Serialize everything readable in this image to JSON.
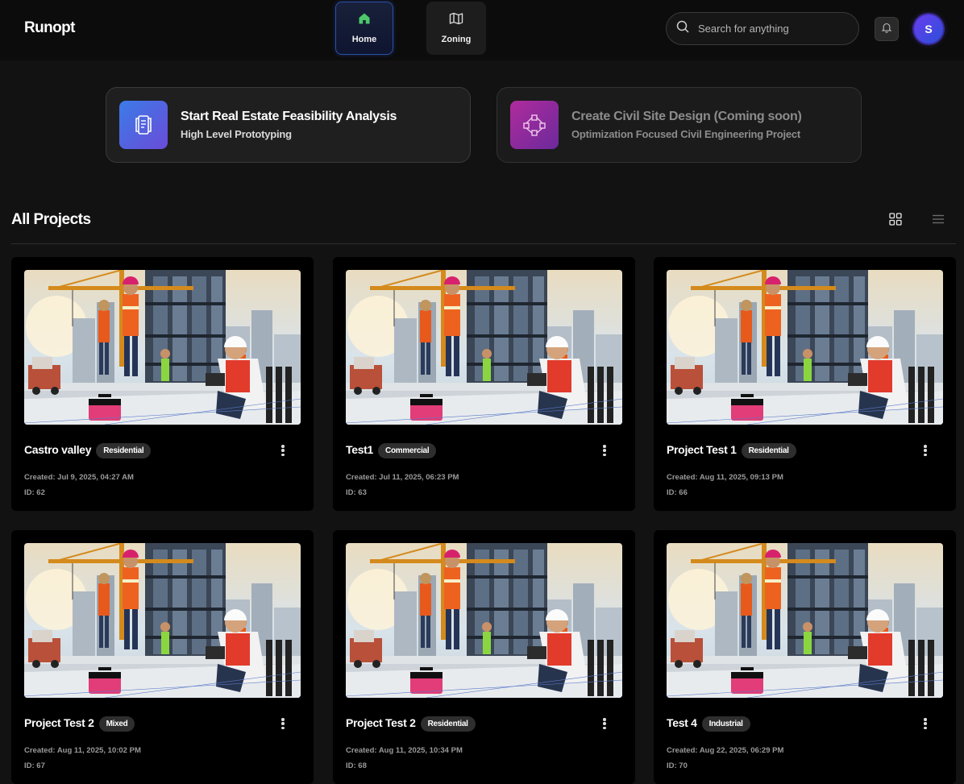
{
  "app": {
    "name": "Runopt"
  },
  "nav": {
    "tabs": [
      {
        "label": "Home",
        "icon": "home-icon",
        "active": true
      },
      {
        "label": "Zoning",
        "icon": "map-icon",
        "active": false
      }
    ]
  },
  "search": {
    "placeholder": "Search for anything",
    "value": ""
  },
  "user": {
    "avatar_initial": "S"
  },
  "actions": [
    {
      "title": "Start Real Estate Feasibility Analysis",
      "subtitle": "High Level Prototyping",
      "icon": "document-icon",
      "enabled": true
    },
    {
      "title": "Create Civil Site Design (Coming soon)",
      "subtitle": "Optimization Focused Civil Engineering Project",
      "icon": "vector-path-icon",
      "enabled": false
    }
  ],
  "projects_section": {
    "title": "All Projects",
    "view": "grid"
  },
  "projects": [
    {
      "name": "Castro valley",
      "type": "Residential",
      "created": "Created: Jul 9, 2025, 04:27 AM",
      "id": "ID: 62"
    },
    {
      "name": "Test1",
      "type": "Commercial",
      "created": "Created: Jul 11, 2025, 06:23 PM",
      "id": "ID: 63"
    },
    {
      "name": "Project Test 1",
      "type": "Residential",
      "created": "Created: Aug 11, 2025, 09:13 PM",
      "id": "ID: 66"
    },
    {
      "name": "Project Test 2",
      "type": "Mixed",
      "created": "Created: Aug 11, 2025, 10:02 PM",
      "id": "ID: 67"
    },
    {
      "name": "Project Test 2",
      "type": "Residential",
      "created": "Created: Aug 11, 2025, 10:34 PM",
      "id": "ID: 68"
    },
    {
      "name": "Test 4",
      "type": "Industrial",
      "created": "Created: Aug 22, 2025, 06:29 PM",
      "id": "ID: 70"
    }
  ],
  "colors": {
    "accent": "#2a4fa8",
    "home_icon": "#4cc76a",
    "avatar": "#5a3de8"
  }
}
